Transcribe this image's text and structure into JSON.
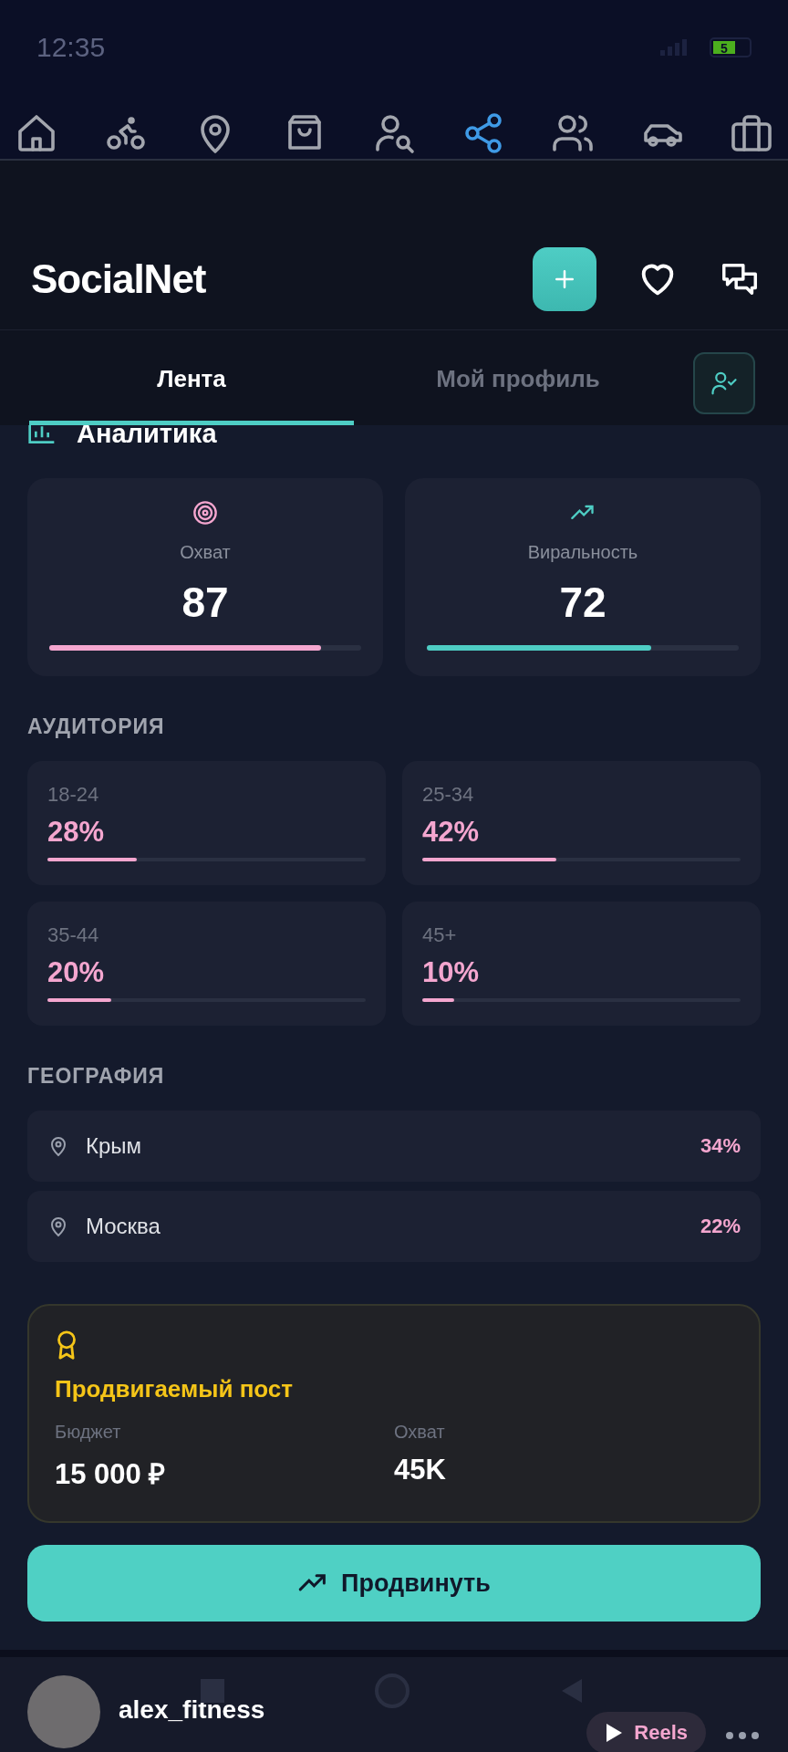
{
  "status_bar": {
    "time": "12:35",
    "battery": "5"
  },
  "nav_icons": [
    {
      "selected": false
    },
    {
      "selected": false
    },
    {
      "selected": false
    },
    {
      "selected": false
    },
    {
      "selected": false
    },
    {
      "selected": true
    },
    {
      "selected": false
    },
    {
      "selected": false
    },
    {
      "selected": false
    }
  ],
  "header": {
    "title": "SocialNet"
  },
  "tabs": [
    {
      "label": "Лента",
      "selected": true
    },
    {
      "label": "Мой профиль",
      "selected": false
    }
  ],
  "analytics": {
    "title": "Аналитика",
    "metrics": [
      {
        "label": "Охват",
        "value": "87",
        "level": 0.87,
        "kind": "target"
      },
      {
        "label": "Виральность",
        "value": "72",
        "level": 0.72,
        "kind": "trend"
      }
    ]
  },
  "audience": {
    "title": "АУДИТОРИЯ",
    "groups": [
      {
        "range": "18-24",
        "percent": "28%",
        "level": 0.28
      },
      {
        "range": "25-34",
        "percent": "42%",
        "level": 0.42
      },
      {
        "range": "35-44",
        "percent": "20%",
        "level": 0.2
      },
      {
        "range": "45+",
        "percent": "10%",
        "level": 0.1
      }
    ]
  },
  "geography": {
    "title": "ГЕОГРАФИЯ",
    "regions": [
      {
        "name": "Крым",
        "percent": "34%"
      },
      {
        "name": "Москва",
        "percent": "22%"
      }
    ]
  },
  "promoted": {
    "title": "Продвигаемый пост",
    "stats": [
      {
        "label": "Бюджет",
        "value": "15 000 ₽"
      },
      {
        "label": "Охват",
        "value": "45K"
      }
    ]
  },
  "promote_button": {
    "label": "Продвинуть"
  },
  "post": {
    "author": "alex_fitness",
    "badge": "Reels"
  }
}
